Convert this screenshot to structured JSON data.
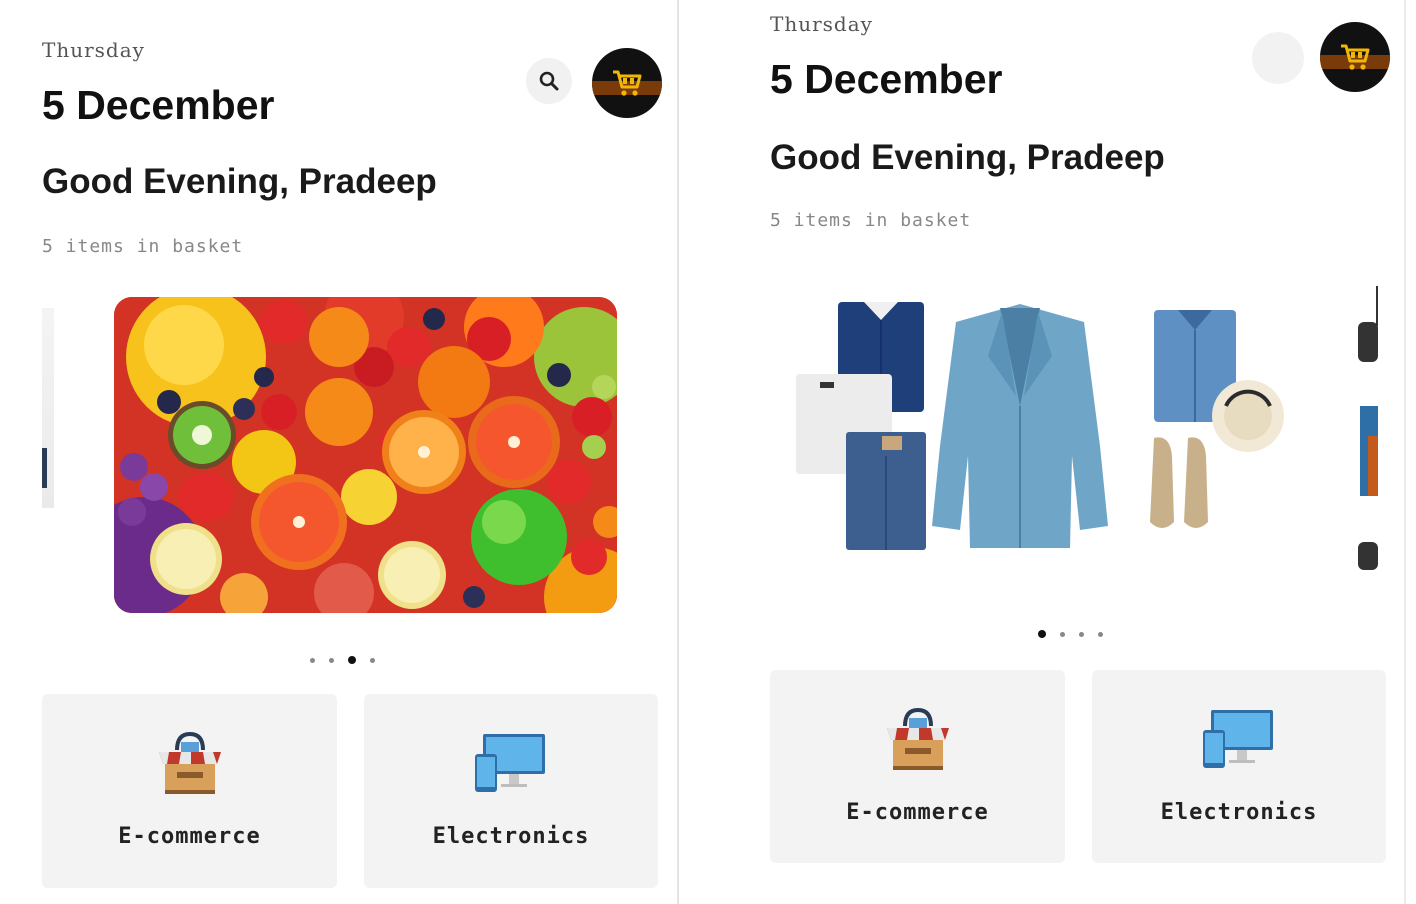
{
  "left": {
    "day": "Thursday",
    "date": "5 December",
    "greeting": "Good Evening, Pradeep",
    "subtitle": "5 items in basket",
    "banner_subject": "fruits",
    "carousel_dots": 4,
    "carousel_active": 2,
    "categories": [
      {
        "label": "E-commerce",
        "icon": "shop-icon"
      },
      {
        "label": "Electronics",
        "icon": "devices-icon"
      }
    ]
  },
  "right": {
    "day": "Thursday",
    "date": "5 December",
    "greeting": "Good Evening, Pradeep",
    "subtitle": "5 items in basket",
    "banner_subject": "clothing",
    "carousel_dots": 4,
    "carousel_active": 0,
    "categories": [
      {
        "label": "E-commerce",
        "icon": "shop-icon"
      },
      {
        "label": "Electronics",
        "icon": "devices-icon"
      }
    ]
  },
  "icons": {
    "search": "search-icon",
    "cart": "cart-icon"
  },
  "colors": {
    "cart_yellow": "#f2b705",
    "cart_bg": "#111111",
    "card_bg": "#f3f3f3",
    "device_blue": "#4aa3df"
  }
}
